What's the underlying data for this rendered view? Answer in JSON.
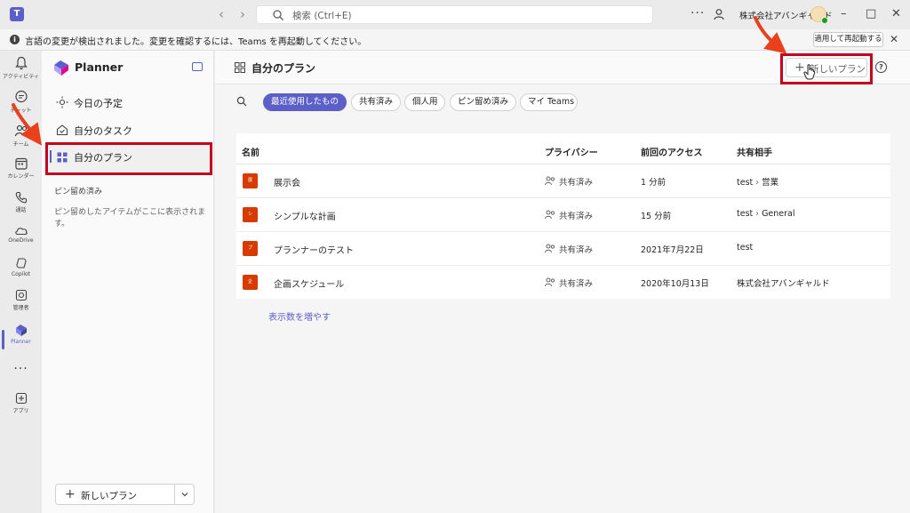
{
  "titlebar": {
    "search_placeholder": "検索 (Ctrl+E)",
    "org_name": "株式会社アバンギャルド",
    "more": "···",
    "back": "‹",
    "forward": "›",
    "minimize": "–",
    "maximize": "□",
    "close": "✕"
  },
  "notification": {
    "message": "言語の変更が検出されました。変更を確認するには、Teams を再起動してください。",
    "restart_button": "適用して再起動する",
    "close": "✕"
  },
  "rail": {
    "items": [
      {
        "label": "アクティビティ",
        "icon": "bell-icon"
      },
      {
        "label": "チャット",
        "icon": "chat-icon"
      },
      {
        "label": "チーム",
        "icon": "teams-icon"
      },
      {
        "label": "カレンダー",
        "icon": "calendar-icon"
      },
      {
        "label": "通話",
        "icon": "phone-icon"
      },
      {
        "label": "OneDrive",
        "icon": "cloud-icon"
      },
      {
        "label": "Copilot",
        "icon": "copilot-icon"
      },
      {
        "label": "管理者",
        "icon": "admin-icon"
      },
      {
        "label": "Planner",
        "icon": "planner-icon"
      },
      {
        "label": "",
        "icon": "more-icon"
      },
      {
        "label": "アプリ",
        "icon": "apps-icon"
      }
    ],
    "more_label": "···"
  },
  "sidebar": {
    "title": "Planner",
    "nav": [
      {
        "label": "今日の予定",
        "icon": "sun-icon"
      },
      {
        "label": "自分のタスク",
        "icon": "home-icon"
      },
      {
        "label": "自分のプラン",
        "icon": "grid-icon"
      }
    ],
    "pinned_header": "ピン留め済み",
    "pinned_empty": "ピン留めしたアイテムがここに表示されます。",
    "new_plan_label": "新しいプラン",
    "plus": "+"
  },
  "main": {
    "title": "自分のプラン",
    "new_plan_label": "新しいプラン",
    "plus": "+",
    "help": "?",
    "filters": [
      "最近使用したもの",
      "共有済み",
      "個人用",
      "ピン留め済み",
      "マイ Teams"
    ],
    "columns": {
      "name": "名前",
      "privacy": "プライバシー",
      "last_access": "前回のアクセス",
      "shared_with": "共有相手"
    },
    "rows": [
      {
        "tile": "展",
        "name": "展示会",
        "privacy": "共有済み",
        "last_access": "1 分前",
        "shared_team": "test",
        "shared_channel": "営業"
      },
      {
        "tile": "シ",
        "name": "シンプルな計画",
        "privacy": "共有済み",
        "last_access": "15 分前",
        "shared_team": "test",
        "shared_channel": "General"
      },
      {
        "tile": "プ",
        "name": "プランナーのテスト",
        "privacy": "共有済み",
        "last_access": "2021年7月22日",
        "shared_team": "test",
        "shared_channel": ""
      },
      {
        "tile": "企",
        "name": "企画スケジュール",
        "privacy": "共有済み",
        "last_access": "2020年10月13日",
        "shared_team": "株式会社アバンギャルド",
        "shared_channel": ""
      }
    ],
    "show_more": "表示数を増やす"
  },
  "colors": {
    "accent": "#5b5fc7",
    "highlight": "#c4001d",
    "arrow": "#e8411c",
    "tile": "#d83b01"
  }
}
